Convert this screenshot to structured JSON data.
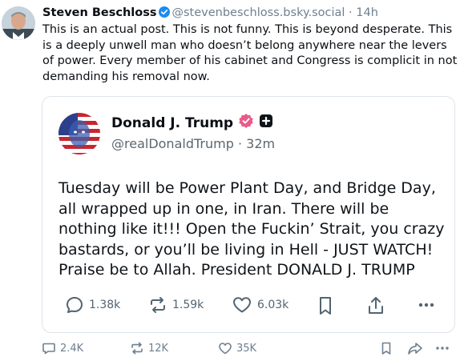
{
  "post": {
    "author_name": "Steven Beschloss",
    "author_handle": "@stevenbeschloss.bsky.social",
    "separator": "·",
    "time": "14h",
    "text": "This is an actual post. This is not funny. This is beyond desperate. This is a deeply unwell man who doesn’t belong anywhere near the levers of power. Every member of his cabinet and Congress is complicit in not demanding his removal now."
  },
  "quoted": {
    "name": "Donald J. Trump",
    "handle": "@realDonaldTrump",
    "separator": "·",
    "time": "32m",
    "text": "Tuesday will be Power Plant Day, and Bridge Day, all wrapped up in one, in Iran. There will be nothing like it!!! Open the Fuckin’ Strait, you crazy bastards, or you’ll be living in Hell - JUST WATCH! Praise be to Allah. President DONALD J. TRUMP",
    "replies": "1.38k",
    "retruths": "1.59k",
    "likes": "6.03k"
  },
  "actions": {
    "replies": "2.4K",
    "reposts": "12K",
    "likes": "35K"
  },
  "colors": {
    "verified_blue": "#1c8cf0",
    "verified_pink": "#e85a8a",
    "icon_gray": "#536471"
  }
}
